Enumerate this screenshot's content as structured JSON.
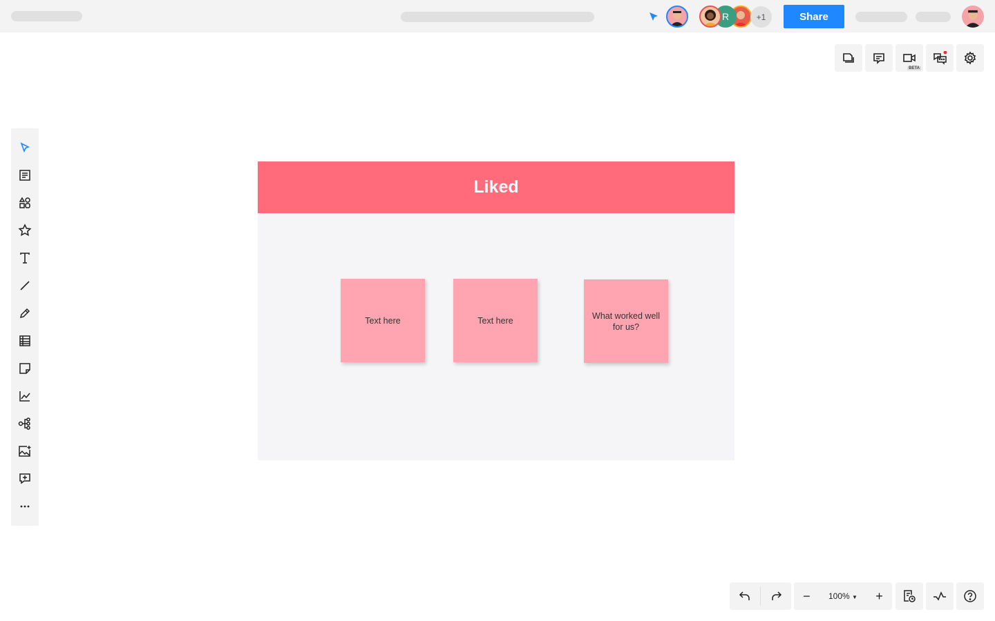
{
  "topbar": {
    "share_label": "Share",
    "collaborators": [
      {
        "initial": "",
        "ring": "#e8505b",
        "bg": "#5a3b2e"
      },
      {
        "initial": "R",
        "ring": "#2f9e7e",
        "bg": "#3a9f80"
      },
      {
        "initial": "",
        "ring": "#f5a623",
        "bg": "#e85a4a"
      }
    ],
    "more_count": "+1",
    "accent": "#1f87ff"
  },
  "right_toolbar": {
    "video_badge": "BETA"
  },
  "frame": {
    "title": "Liked",
    "header_color": "#ff6b7b",
    "stickies": [
      {
        "text": "Text here"
      },
      {
        "text": "Text here"
      },
      {
        "text": "What worked well for us?"
      }
    ],
    "sticky_color": "#ffa4b0"
  },
  "bottom_toolbar": {
    "zoom_level": "100%"
  }
}
